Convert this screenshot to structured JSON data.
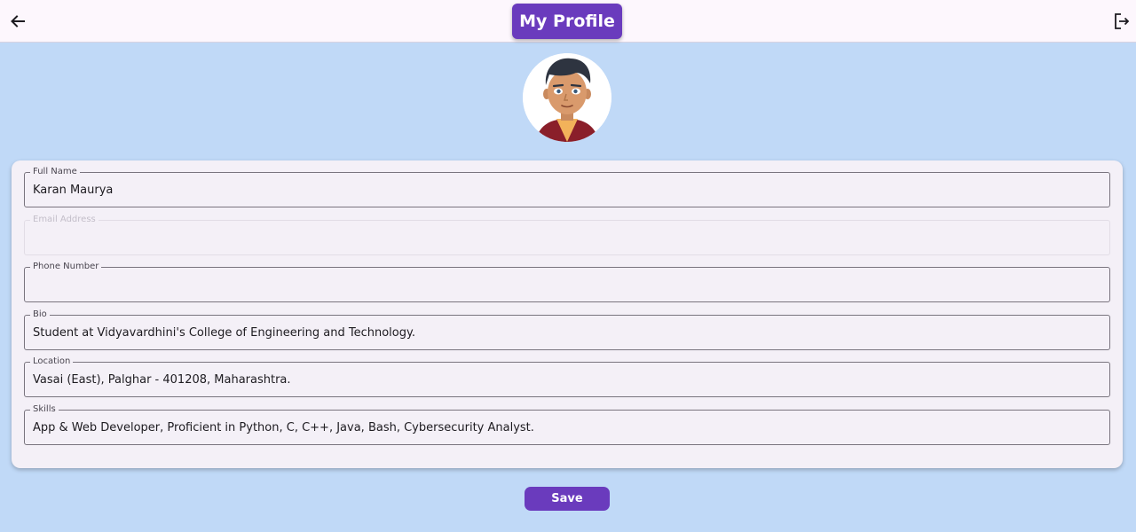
{
  "header": {
    "title": "My Profile",
    "back_icon": "arrow-left-icon",
    "logout_icon": "logout-icon"
  },
  "avatar": {
    "icon": "cartoon-boy-avatar"
  },
  "form": {
    "fields": [
      {
        "label": "Full Name",
        "value": "Karan Maurya"
      },
      {
        "label": "Email Address",
        "value": ""
      },
      {
        "label": "Phone Number",
        "value": ""
      },
      {
        "label": "Bio",
        "value": "Student at Vidyavardhini's College of Engineering and Technology."
      },
      {
        "label": "Location",
        "value": "Vasai (East), Palghar - 401208, Maharashtra."
      },
      {
        "label": "Skills",
        "value": "App & Web Developer, Proficient in Python, C, C++, Java, Bash, Cybersecurity Analyst."
      }
    ]
  },
  "save_label": "Save",
  "colors": {
    "accent": "#6a3bbd",
    "background": "#c0d9f7",
    "appbar": "#fdf7fd",
    "card": "#f4f0f7"
  }
}
